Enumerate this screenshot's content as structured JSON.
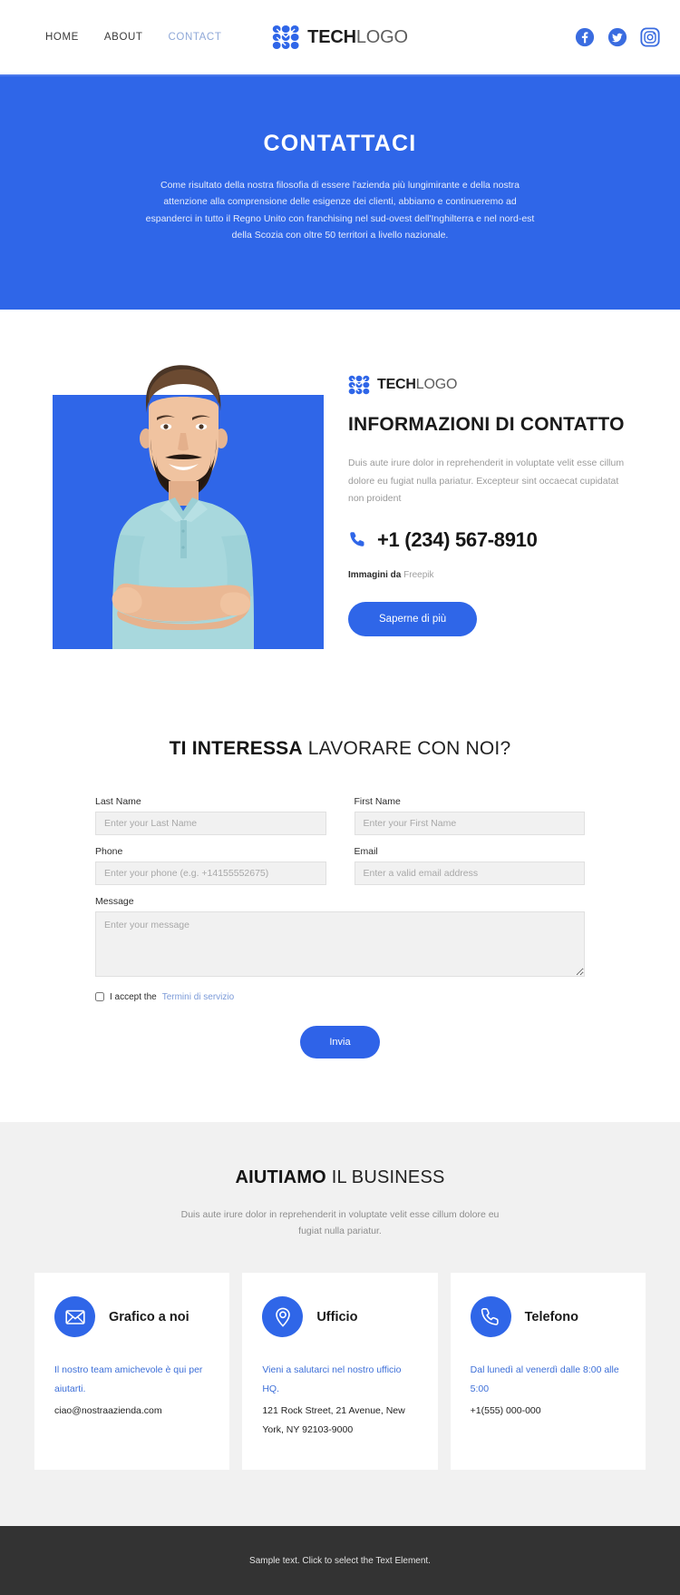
{
  "header": {
    "nav": [
      {
        "label": "HOME",
        "active": false
      },
      {
        "label": "ABOUT",
        "active": false
      },
      {
        "label": "CONTACT",
        "active": true
      }
    ],
    "logo": {
      "bold": "TECH",
      "light": "LOGO"
    },
    "socials": [
      {
        "name": "facebook-icon"
      },
      {
        "name": "twitter-icon"
      },
      {
        "name": "instagram-icon"
      }
    ]
  },
  "hero": {
    "title": "CONTATTACI",
    "paragraph": "Come risultato della nostra filosofia di essere l'azienda più lungimirante e della nostra attenzione alla comprensione delle esigenze dei clienti, abbiamo e continueremo ad espanderci in tutto il Regno Unito con franchising nel sud-ovest dell'Inghilterra e nel nord-est della Scozia con oltre 50 territori a livello nazionale."
  },
  "info": {
    "logo": {
      "bold": "TECH",
      "light": "LOGO"
    },
    "heading": "INFORMAZIONI DI CONTATTO",
    "description": "Duis aute irure dolor in reprehenderit in voluptate velit esse cillum dolore eu fugiat nulla pariatur. Excepteur sint occaecat cupidatat non proident",
    "phone": "+1 (234) 567-8910",
    "credit_label": "Immagini da",
    "credit_source": "Freepik",
    "cta_label": "Saperne di più",
    "photo_alt": "smiling-bearded-man-crossed-arms"
  },
  "form": {
    "title_bold": "TI INTERESSA",
    "title_light": " LAVORARE CON NOI?",
    "fields": [
      {
        "name": "last-name",
        "label": "Last Name",
        "placeholder": "Enter your Last Name",
        "value": ""
      },
      {
        "name": "first-name",
        "label": "First Name",
        "placeholder": "Enter your First Name",
        "value": ""
      },
      {
        "name": "phone",
        "label": "Phone",
        "placeholder": "Enter your phone (e.g. +14155552675)",
        "value": ""
      },
      {
        "name": "email",
        "label": "Email",
        "placeholder": "Enter a valid email address",
        "value": ""
      }
    ],
    "message": {
      "label": "Message",
      "placeholder": "Enter your message",
      "value": ""
    },
    "accept_text": "I accept the",
    "accept_link": "Termini di servizio",
    "accept_checked": false,
    "submit_label": "Invia"
  },
  "business": {
    "title_bold": "AIUTIAMO",
    "title_light": " IL BUSINESS",
    "subtitle": "Duis aute irure dolor in reprehenderit in voluptate velit esse cillum dolore eu fugiat nulla pariatur.",
    "cards": [
      {
        "icon": "envelope-icon",
        "title": "Grafico a noi",
        "blue_text": "Il nostro team amichevole è qui per aiutarti.",
        "dark_text": "ciao@nostraazienda.com"
      },
      {
        "icon": "map-pin-icon",
        "title": "Ufficio",
        "blue_text": "Vieni a salutarci nel nostro ufficio HQ.",
        "dark_text": "121 Rock Street, 21 Avenue, New York, NY 92103-9000"
      },
      {
        "icon": "phone-icon",
        "title": "Telefono",
        "blue_text": "Dal lunedì al venerdì dalle 8:00 alle 5:00",
        "dark_text": "+1(555) 000-000"
      }
    ]
  },
  "footer": {
    "text": "Sample text. Click to select the Text Element."
  },
  "colors": {
    "brand_blue": "#2f66e8",
    "hero_blue": "#2f66e8",
    "nav_active": "#8fa8d8",
    "section_gray": "#f1f1f1",
    "footer_dark": "#333333",
    "muted_text": "#9a9a9a"
  }
}
